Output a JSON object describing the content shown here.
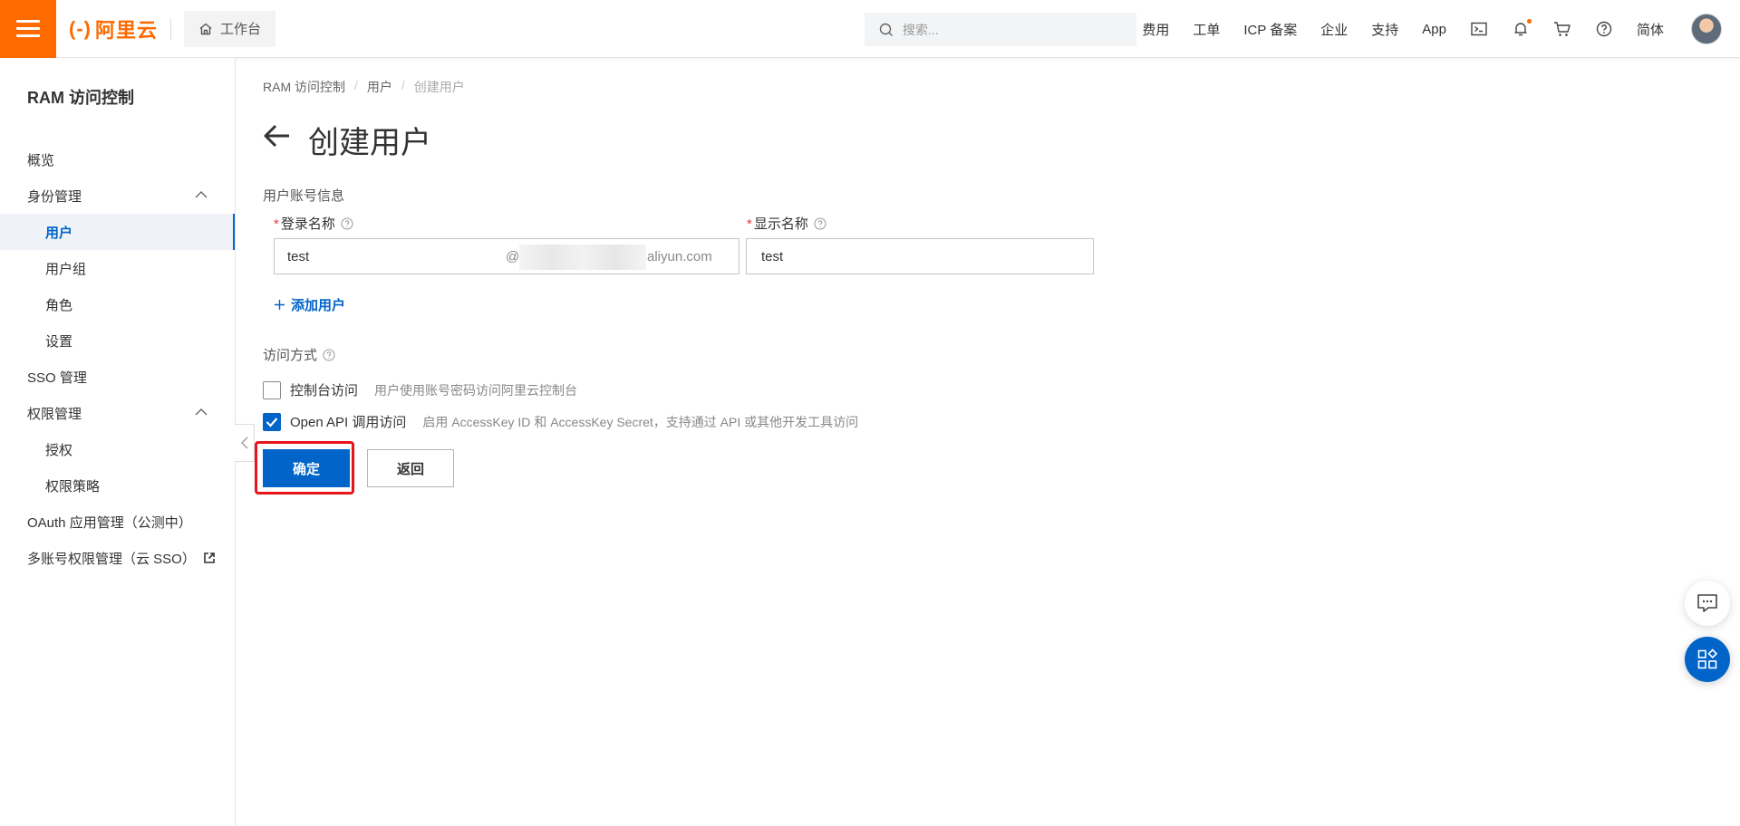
{
  "topbar": {
    "logo_text": "阿里云",
    "workbench_label": "工作台",
    "search_placeholder": "搜索...",
    "links": [
      "费用",
      "工单",
      "ICP 备案",
      "企业",
      "支持",
      "App"
    ],
    "lang_label": "简体"
  },
  "sidebar": {
    "title": "RAM 访问控制",
    "items": [
      {
        "label": "概览"
      },
      {
        "label": "身份管理"
      },
      {
        "label": "用户"
      },
      {
        "label": "用户组"
      },
      {
        "label": "角色"
      },
      {
        "label": "设置"
      },
      {
        "label": "SSO 管理"
      },
      {
        "label": "权限管理"
      },
      {
        "label": "授权"
      },
      {
        "label": "权限策略"
      },
      {
        "label": "OAuth 应用管理（公测中）"
      },
      {
        "label": "多账号权限管理（云 SSO）"
      }
    ]
  },
  "main": {
    "breadcrumb": [
      "RAM 访问控制",
      "用户",
      "创建用户"
    ],
    "title": "创建用户",
    "section_label": "用户账号信息",
    "login_name_label": "登录名称",
    "display_name_label": "显示名称",
    "login_name_value": "test",
    "domain_at": "@",
    "domain_suffix": "aliyun.com",
    "display_name_value": "test",
    "add_user_label": "添加用户",
    "access_label": "访问方式",
    "console_access_label": "控制台访问",
    "console_access_desc": "用户使用账号密码访问阿里云控制台",
    "console_access_checked": false,
    "api_access_label": "Open API 调用访问",
    "api_access_desc": "启用 AccessKey ID 和 AccessKey Secret，支持通过 API 或其他开发工具访问",
    "api_access_checked": true,
    "confirm_label": "确定",
    "back_label": "返回"
  },
  "colors": {
    "brand_orange": "#ff6a00",
    "primary_blue": "#0064c8",
    "highlight_red": "#e8141b"
  }
}
